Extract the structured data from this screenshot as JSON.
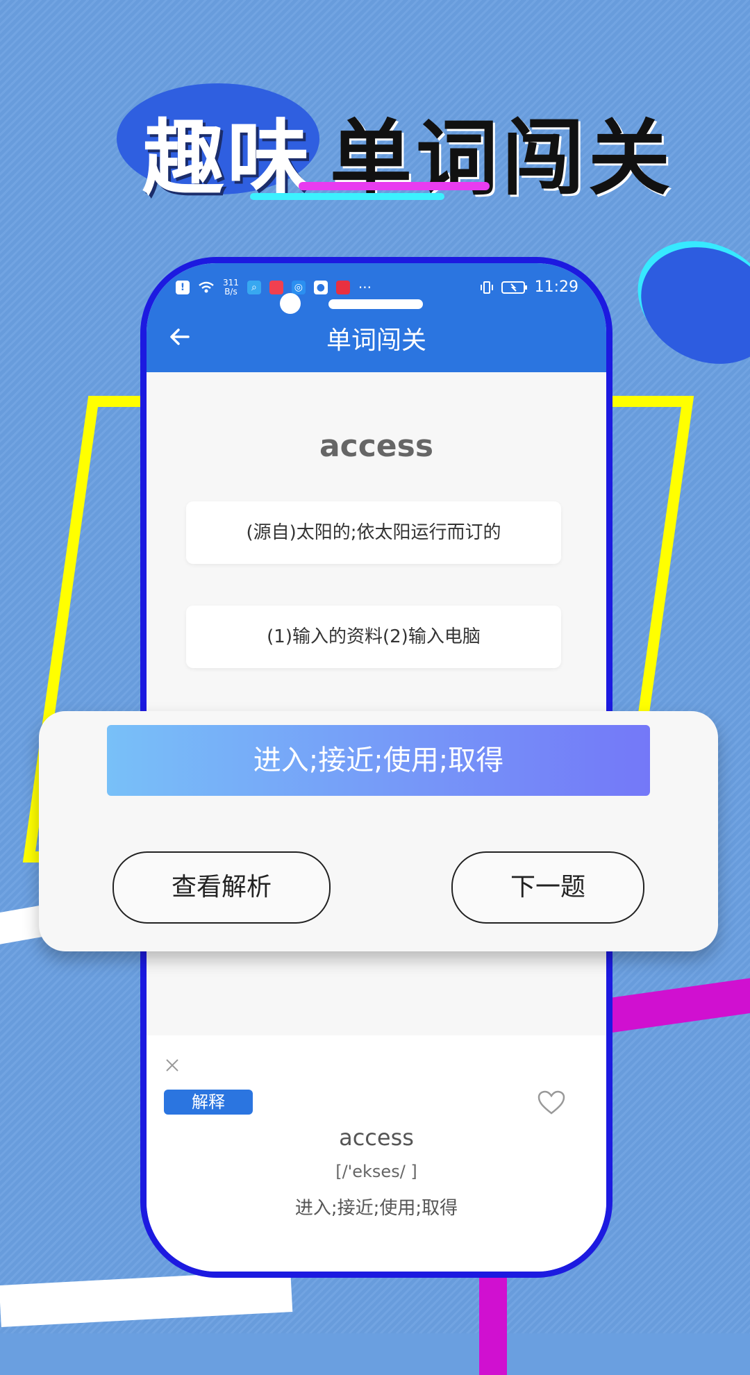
{
  "promo": {
    "highlight": "趣味",
    "title": "单词闯关"
  },
  "status_bar": {
    "net_speed_top": "311",
    "net_speed_bottom": "B/s",
    "more": "···",
    "time": "11:29"
  },
  "appbar": {
    "title": "单词闯关"
  },
  "quiz": {
    "word": "access",
    "options": [
      "(源自)太阳的;依太阳运行而订的",
      "(1)输入的资料(2)输入电脑"
    ],
    "selected_answer": "进入;接近;使用;取得",
    "buttons": {
      "analysis": "查看解析",
      "next": "下一题"
    }
  },
  "explanation": {
    "badge": "解释",
    "word": "access",
    "phonetic": "[/'ekses/ ]",
    "meaning": "进入;接近;使用;取得"
  },
  "colors": {
    "primary": "#2b75e0",
    "phone_frame": "#1c1ae0",
    "background": "#6a9fe0",
    "accent_pink": "#e83cf0",
    "accent_cyan": "#3cf1ff",
    "frame_yellow": "#ffff00"
  },
  "icons": [
    "back-arrow-icon",
    "close-icon",
    "heart-icon",
    "wifi-icon",
    "battery-icon",
    "vibrate-icon",
    "alert-icon"
  ]
}
